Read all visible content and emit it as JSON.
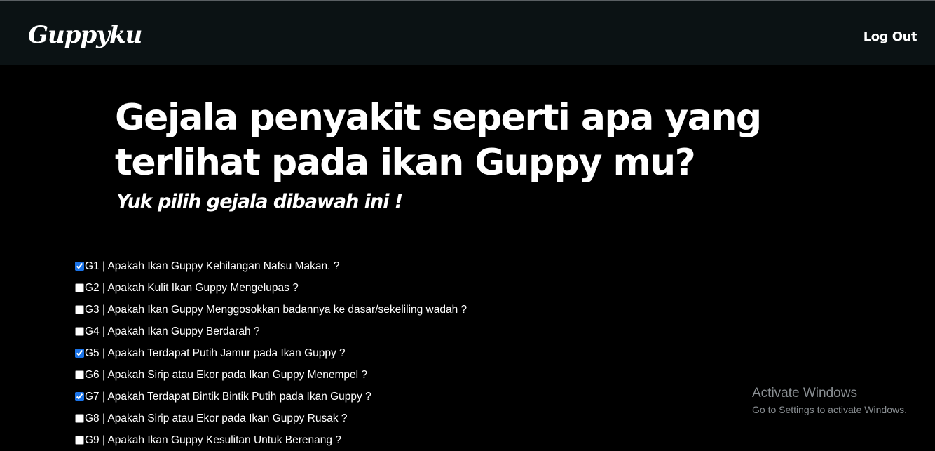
{
  "header": {
    "brand": "Guppyku",
    "logout_label": "Log Out"
  },
  "main": {
    "title": "Gejala penyakit seperti apa yang terlihat pada ikan Guppy mu?",
    "subtitle": "Yuk pilih gejala dibawah ini !",
    "symptoms": [
      {
        "label": "G1 | Apakah Ikan Guppy Kehilangan Nafsu Makan. ?",
        "checked": true
      },
      {
        "label": "G2 | Apakah Kulit Ikan Guppy Mengelupas ?",
        "checked": false
      },
      {
        "label": "G3 | Apakah Ikan Guppy Menggosokkan badannya ke dasar/sekeliling wadah ?",
        "checked": false
      },
      {
        "label": "G4 | Apakah Ikan Guppy Berdarah ?",
        "checked": false
      },
      {
        "label": "G5 | Apakah Terdapat Putih Jamur pada Ikan Guppy ?",
        "checked": true
      },
      {
        "label": "G6 | Apakah Sirip atau Ekor pada Ikan Guppy Menempel ?",
        "checked": false
      },
      {
        "label": "G7 | Apakah Terdapat Bintik Bintik Putih pada Ikan Guppy ?",
        "checked": true
      },
      {
        "label": "G8 | Apakah Sirip atau Ekor pada Ikan Guppy Rusak ?",
        "checked": false
      },
      {
        "label": "G9 | Apakah Ikan Guppy Kesulitan Untuk Berenang ?",
        "checked": false
      }
    ]
  },
  "watermark": {
    "title": "Activate Windows",
    "subtitle": "Go to Settings to activate Windows."
  }
}
